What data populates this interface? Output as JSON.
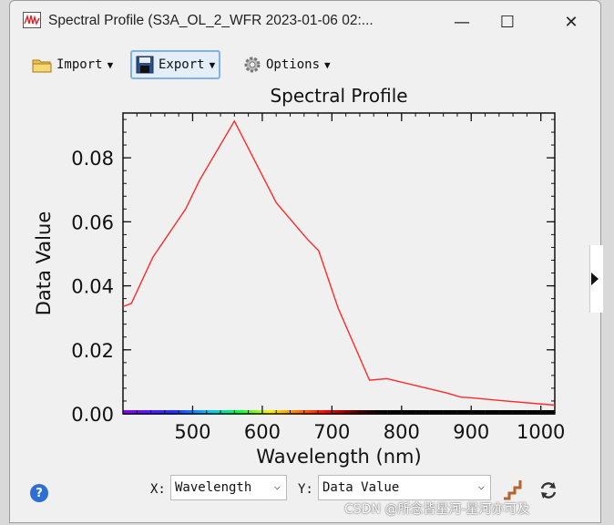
{
  "window": {
    "title": "Spectral Profile (S3A_OL_2_WFR 2023-01-06 02:...",
    "minimize_glyph": "—",
    "maximize_glyph": "☐",
    "close_glyph": "✕"
  },
  "toolbar": {
    "import_label": "Import",
    "export_label": "Export",
    "options_label": "Options"
  },
  "chart_data": {
    "type": "line",
    "title": "Spectral Profile",
    "xlabel": "Wavelength (nm)",
    "ylabel": "Data Value",
    "xlim": [
      400,
      1020
    ],
    "ylim": [
      0,
      0.094
    ],
    "x_ticks": [
      500,
      600,
      700,
      800,
      900,
      1000
    ],
    "x_tick_labels": [
      "500",
      "600",
      "700",
      "800",
      "900",
      "1000"
    ],
    "y_ticks": [
      0,
      0.02,
      0.04,
      0.06,
      0.08
    ],
    "y_tick_labels": [
      "0.00",
      "0.02",
      "0.04",
      "0.06",
      "0.08"
    ],
    "series": [
      {
        "color": "#ff2a2a",
        "x": [
          400,
          412,
          443,
          490,
          510,
          560,
          620,
          665,
          681,
          709,
          754,
          779,
          865,
          885,
          900,
          940,
          1020
        ],
        "y": [
          0.0335,
          0.0345,
          0.049,
          0.064,
          0.073,
          0.0915,
          0.066,
          0.0545,
          0.051,
          0.033,
          0.0105,
          0.011,
          0.0065,
          0.0052,
          0.005,
          0.0042,
          0.0027
        ]
      }
    ],
    "grid": false,
    "spectrum_bar": true
  },
  "bottom": {
    "x_label": "X:",
    "x_value": "Wavelength",
    "y_label": "Y:",
    "y_value": "Data Value"
  },
  "watermark": "CSDN @所念皆星河-星河亦可及"
}
